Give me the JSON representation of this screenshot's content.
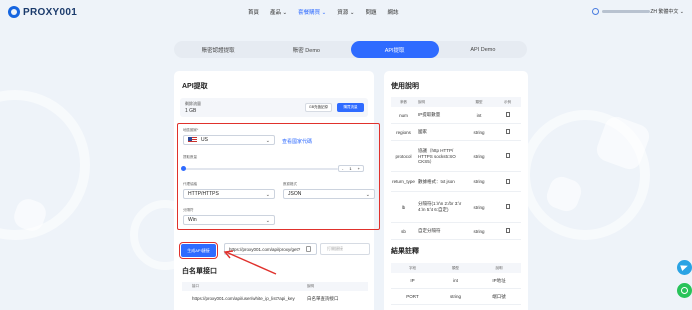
{
  "brand": {
    "logo_text": "PROXY001"
  },
  "nav": {
    "items": [
      "首頁",
      "產品 ⌄",
      "套餐購買 ⌄",
      "資源 ⌄",
      "問題",
      "網誌"
    ],
    "active_index": 2
  },
  "header": {
    "lang": "ZH 繁體中文 ⌄"
  },
  "tabs": [
    "賬密認證提取",
    "賬密 Demo",
    "API提取",
    "API Demo"
  ],
  "active_tab": 2,
  "api_card": {
    "title": "API提取",
    "balance_label": "剩餘流量",
    "balance_value": "1 GB",
    "btn_history": "GB充值記錄",
    "btn_topup": "購買流量",
    "country_label": "地區國家*",
    "country_value": "US",
    "country_link": "查看國家代碼",
    "count_label": "提取數量",
    "count_value": "1",
    "protocol_label": "代理協議",
    "protocol_value": "HTTP/HTTPS",
    "format_label": "數據格式",
    "format_value": "JSON",
    "separator_label": "分隔符",
    "separator_value": "Win",
    "gen_button": "生成API鏈接",
    "api_url": "https://proxy001.com/api/proxy/get?",
    "open_button": "打開鏈接"
  },
  "whitelist": {
    "title": "白名單接口",
    "headers": [
      "接口",
      "說明"
    ],
    "rows": [
      [
        "https://proxy001.com/api/user/white_ip_list?api_key",
        "白名單查詢接口"
      ]
    ]
  },
  "usage": {
    "title": "使用說明",
    "headers": [
      "參數",
      "說明",
      "類型",
      "示例"
    ],
    "rows": [
      [
        "num",
        "IP提取數量",
        "int",
        ""
      ],
      [
        "regions",
        "國家",
        "string",
        ""
      ],
      [
        "protocol",
        "協議（http HTTP/ HTTPS socks5:SO CKS5）",
        "string",
        ""
      ],
      [
        "return_type",
        "數據格式：txt json",
        "string",
        ""
      ],
      [
        "lb",
        "分隔符(1:\\r\\n 2:/br 3:\\r 4:\\n 5:\\t 6:自定)",
        "string",
        ""
      ],
      [
        "sb",
        "自定分隔符",
        "string",
        ""
      ]
    ]
  },
  "result": {
    "title": "結果註釋",
    "headers": [
      "字段",
      "類型",
      "說明"
    ],
    "rows": [
      [
        "IP",
        "int",
        "IP地址"
      ],
      [
        "PORT",
        "string",
        "端口號"
      ]
    ]
  },
  "colors": {
    "accent": "#2f6bff",
    "highlight_red": "#e0312c",
    "telegram": "#2aa3e4",
    "whatsapp": "#28c35a"
  }
}
